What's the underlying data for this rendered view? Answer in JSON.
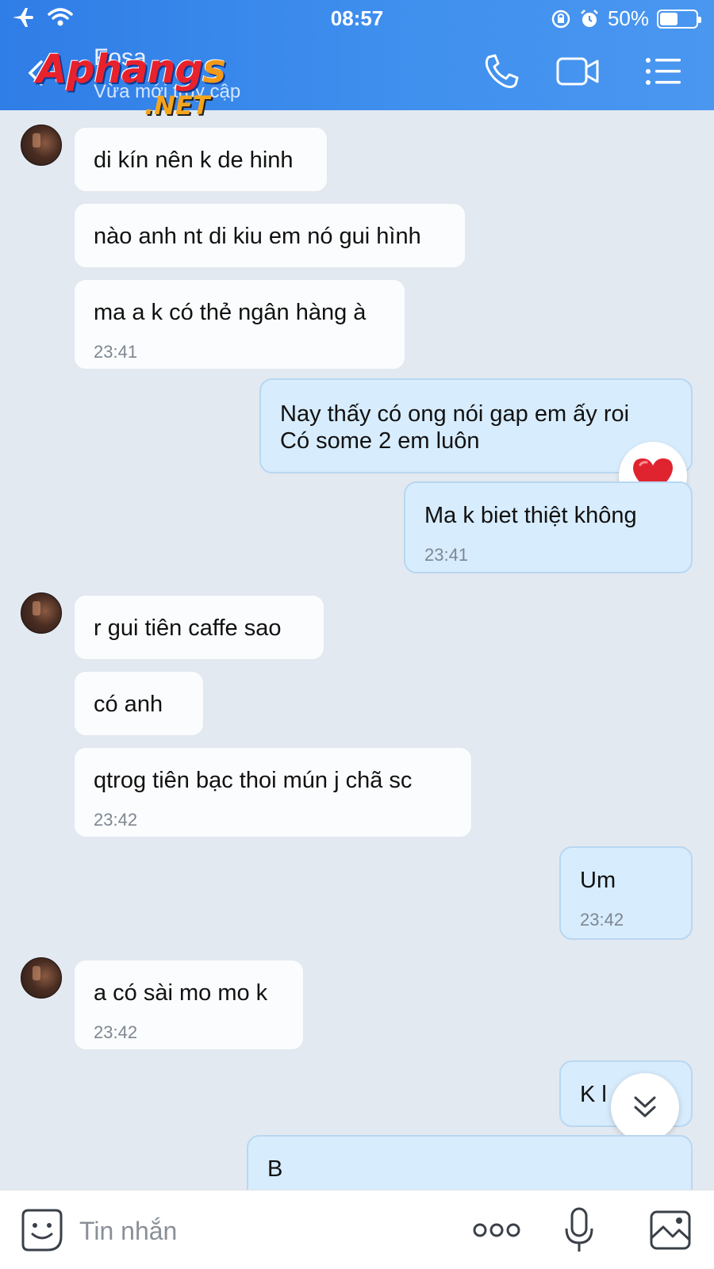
{
  "status_bar": {
    "time": "08:57",
    "battery_text": "50%",
    "battery_level": 0.5
  },
  "header": {
    "contact_name": "Fosa",
    "contact_status": "Vừa mới truy cập",
    "watermark_main": "Aphang",
    "watermark_s": "s",
    "watermark_net": ".NET",
    "icons": [
      "phone-icon",
      "video-icon",
      "menu-icon"
    ]
  },
  "messages": [
    {
      "dir": "in",
      "text": "di kín nên k de hinh",
      "avatar": true
    },
    {
      "dir": "in",
      "text": "nào anh nt di kiu em nó gui hình"
    },
    {
      "dir": "in",
      "text": "ma a k có thẻ ngân hàng à",
      "time": "23:41"
    },
    {
      "dir": "out",
      "text": "Nay thấy có ong nói gap em ấy roi",
      "text2": "Có some 2 em luôn",
      "reaction": "heart"
    },
    {
      "dir": "out",
      "text": "Ma k biet thiệt không",
      "time": "23:41"
    },
    {
      "dir": "in",
      "text": "r gui tiên caffe sao",
      "avatar": true
    },
    {
      "dir": "in",
      "text": "có anh"
    },
    {
      "dir": "in",
      "text": "qtrog tiên bạc thoi mún j chã sc",
      "time": "23:42"
    },
    {
      "dir": "out",
      "text": "Um",
      "time": "23:42"
    },
    {
      "dir": "in",
      "text": "a có sài mo mo k",
      "time": "23:42",
      "avatar": true
    },
    {
      "dir": "out",
      "text": "K l"
    },
    {
      "dir": "out",
      "text": "B"
    }
  ],
  "composer": {
    "placeholder": "Tin nhắn"
  },
  "colors": {
    "header_start": "#2f7de6",
    "header_end": "#4a97f0",
    "incoming_bubble": "#fbfcfd",
    "outgoing_bubble": "#d7ecfd",
    "chat_background": "#e3e9f0"
  }
}
